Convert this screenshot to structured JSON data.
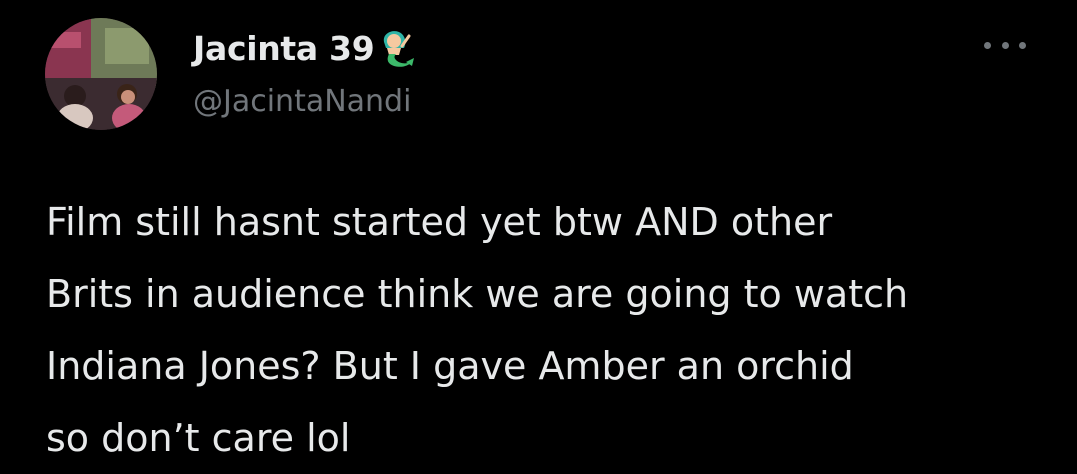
{
  "author": {
    "display_name": "Jacinta 39",
    "name_emoji": "mermaid-emoji",
    "handle": "@JacintaNandi"
  },
  "tweet": {
    "lines": [
      "Film still hasnt started yet btw AND other",
      "Brits in audience think we are going to watch",
      "Indiana Jones? But I gave Amber an orchid",
      "so don’t care lol"
    ]
  },
  "icons": {
    "more": "more-options-icon"
  },
  "colors": {
    "background": "#000000",
    "primary_text": "#e7e9ea",
    "secondary_text": "#71767b"
  }
}
